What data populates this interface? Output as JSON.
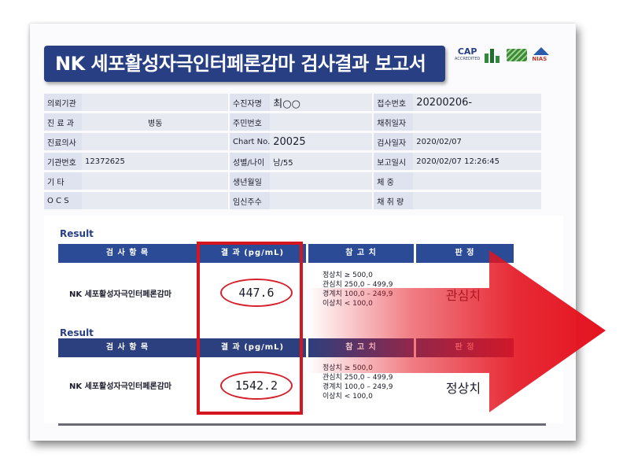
{
  "report_title": "NK 세포활성자극인터페론감마 검사결과 보고서",
  "logos": {
    "cap_main": "CAP",
    "cap_sub": "ACCREDITED",
    "nias_text": "NIAS",
    "icon_names": [
      "cap-logo",
      "lh-logo",
      "koa-logo",
      "nias-logo"
    ]
  },
  "patient_info": {
    "rows": [
      [
        {
          "label": "의뢰기관",
          "value": ""
        },
        {
          "label": "수진자명",
          "value": "최○○"
        },
        {
          "label": "접수번호",
          "value": "20200206-"
        }
      ],
      [
        {
          "label": "진 료 과",
          "value": "병동"
        },
        {
          "label": "주민번호",
          "value": ""
        },
        {
          "label": "채취일자",
          "value": ""
        }
      ],
      [
        {
          "label": "진료의사",
          "value": ""
        },
        {
          "label": "Chart No.",
          "value": "20025"
        },
        {
          "label": "검사일자",
          "value": "2020/02/07"
        }
      ],
      [
        {
          "label": "기관번호",
          "value": "12372625"
        },
        {
          "label": "성별/나이",
          "value": "남/55"
        },
        {
          "label": "보고일시",
          "value": "2020/02/07  12:26:45"
        }
      ],
      [
        {
          "label": "기   타",
          "value": ""
        },
        {
          "label": "생년월일",
          "value": ""
        },
        {
          "label": "체   중",
          "value": ""
        }
      ],
      [
        {
          "label": "O C S",
          "value": ""
        },
        {
          "label": "임신주수",
          "value": ""
        },
        {
          "label": "채 취 량",
          "value": ""
        }
      ]
    ]
  },
  "results": [
    {
      "heading": "Result",
      "headers": [
        "검 사 항 목",
        "결 과 (pg/mL)",
        "참 고 치",
        "판   정"
      ],
      "item": "NK 세포활성자극인터페론감마",
      "value": "447.6",
      "reference": [
        "정상치 ≥ 500,0",
        "관심치 250,0 – 499,9",
        "경계치 100,0 – 249,9",
        "이상치 < 100,0"
      ],
      "judgement": "관심치"
    },
    {
      "heading": "Result",
      "headers": [
        "검 사 항 목",
        "결 과 (pg/mL)",
        "참 고 치",
        "판   정"
      ],
      "item": "NK 세포활성자극인터페론감마",
      "value": "1542.2",
      "reference": [
        "정상치 ≥ 500,0",
        "관심치 250,0 – 499,9",
        "경계치 100,0 – 249,9",
        "이상치 < 100,0"
      ],
      "judgement": "정상치"
    }
  ],
  "colors": {
    "banner": "#283f84",
    "header": "#2c4b96",
    "highlight": "#d5161f",
    "arrow": "#e4131f"
  }
}
